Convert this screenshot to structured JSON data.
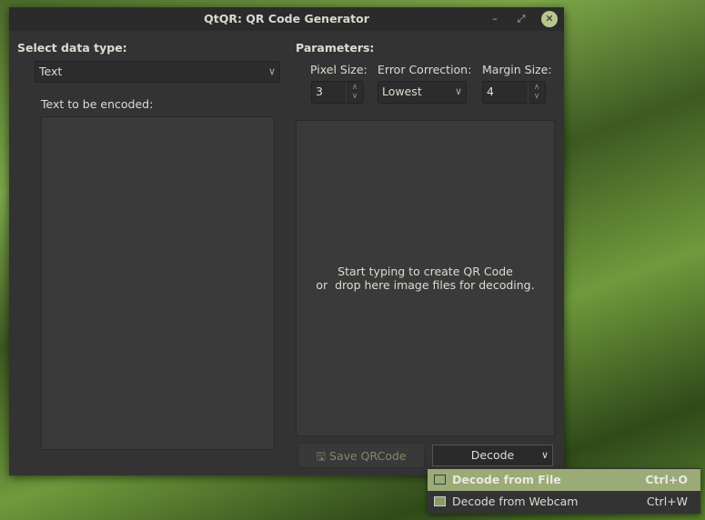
{
  "window": {
    "title": "QtQR: QR Code Generator"
  },
  "left": {
    "select_label": "Select data type:",
    "data_type": "Text",
    "text_label": "Text to be encoded:",
    "text_value": ""
  },
  "params": {
    "label": "Parameters:",
    "pixel_size_label": "Pixel Size:",
    "pixel_size": "3",
    "error_label": "Error Correction:",
    "error_value": "Lowest",
    "margin_label": "Margin Size:",
    "margin": "4"
  },
  "preview": {
    "line1": "Start typing to create QR Code",
    "line2": "or  drop here image files for decoding."
  },
  "buttons": {
    "save": "Save QRCode",
    "decode": "Decode"
  },
  "menu": [
    {
      "label": "Decode from File",
      "shortcut": "Ctrl+O"
    },
    {
      "label": "Decode from Webcam",
      "shortcut": "Ctrl+W"
    }
  ],
  "colors": {
    "accent": "#9aab78"
  }
}
